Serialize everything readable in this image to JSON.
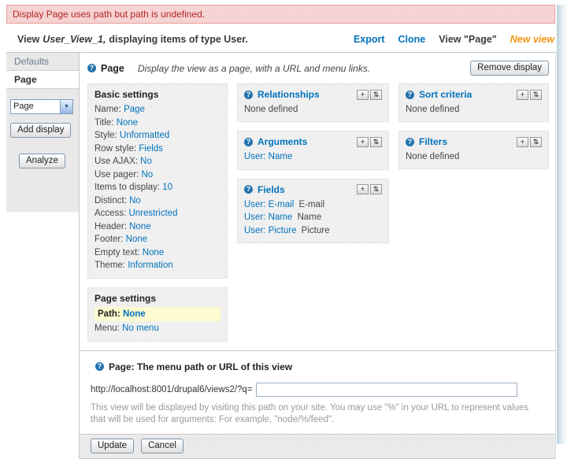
{
  "colors": {
    "accent_blue": "#0272bb",
    "error_red": "#b32424",
    "highlight_yellow": "#fdfbd0",
    "new_view_orange": "#f29513"
  },
  "error": {
    "message": "Display Page uses path but path is undefined."
  },
  "view_bar": {
    "prefix": "View",
    "view_name": "User_View_1,",
    "suffix": "displaying items of type User.",
    "links": {
      "export": "Export",
      "clone": "Clone",
      "view_page": "View \"Page\"",
      "new_view": "New view"
    }
  },
  "tabs": {
    "defaults": "Defaults",
    "page": "Page"
  },
  "display_selector": {
    "value": "Page"
  },
  "buttons": {
    "add_display": "Add display",
    "analyze": "Analyze",
    "remove_display": "Remove display",
    "update": "Update",
    "cancel": "Cancel"
  },
  "display_header": {
    "title": "Page",
    "description": "Display the view as a page, with a URL and menu links."
  },
  "basic_settings": {
    "title": "Basic settings",
    "items": [
      {
        "label": "Name:",
        "value": "Page"
      },
      {
        "label": "Title:",
        "value": "None"
      },
      {
        "label": "Style:",
        "value": "Unformatted"
      },
      {
        "label": "Row style:",
        "value": "Fields"
      },
      {
        "label": "Use AJAX:",
        "value": "No"
      },
      {
        "label": "Use pager:",
        "value": "No"
      },
      {
        "label": "Items to display:",
        "value": "10"
      },
      {
        "label": "Distinct:",
        "value": "No"
      },
      {
        "label": "Access:",
        "value": "Unrestricted"
      },
      {
        "label": "Header:",
        "value": "None"
      },
      {
        "label": "Footer:",
        "value": "None"
      },
      {
        "label": "Empty text:",
        "value": "None"
      },
      {
        "label": "Theme:",
        "value": "Information"
      }
    ]
  },
  "page_settings": {
    "title": "Page settings",
    "path": {
      "label": "Path:",
      "value": "None"
    },
    "menu": {
      "label": "Menu:",
      "value": "No menu"
    }
  },
  "sections": {
    "relationships": {
      "title": "Relationships",
      "empty": "None defined"
    },
    "arguments": {
      "title": "Arguments",
      "items": [
        {
          "link": "User: Name"
        }
      ]
    },
    "fields": {
      "title": "Fields",
      "items": [
        {
          "link": "User: E-mail",
          "label": "E-mail"
        },
        {
          "link": "User: Name",
          "label": "Name"
        },
        {
          "link": "User: Picture",
          "label": "Picture"
        }
      ]
    },
    "sort_criteria": {
      "title": "Sort criteria",
      "empty": "None defined"
    },
    "filters": {
      "title": "Filters",
      "empty": "None defined"
    }
  },
  "path_form": {
    "title": "Page: The menu path or URL of this view",
    "url_prefix": "http://localhost:8001/drupal6/views2/?q=",
    "input_value": "",
    "description": "This view will be displayed by visiting this path on your site. You may use \"%\" in your URL to represent values that will be used for arguments: For example, \"node/%/feed\"."
  },
  "icons": {
    "help": "?",
    "add": "+",
    "rearrange": "⇅",
    "select_arrow": "▼"
  }
}
